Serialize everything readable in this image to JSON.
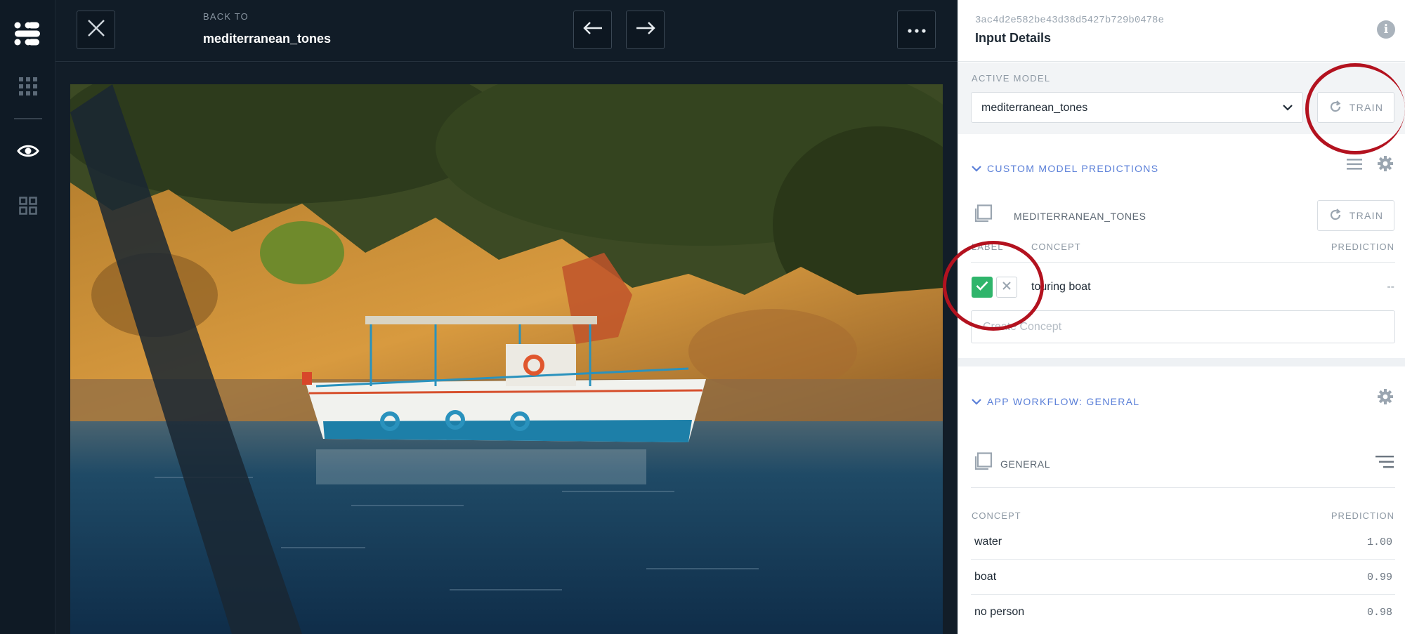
{
  "nav": {
    "back_to_label": "BACK TO",
    "back_to_name": "mediterranean_tones"
  },
  "icons": {
    "logo": "logo-icon",
    "apps": "grid-icon",
    "explorer": "eye-icon",
    "modules": "tiles-icon",
    "close": "close-icon",
    "prev": "arrow-left-icon",
    "next": "arrow-right-icon",
    "more": "more-dots-icon",
    "info": "info-icon",
    "refresh": "refresh-icon",
    "settings": "gear-icon",
    "list": "list-icon",
    "sort": "sort-icon",
    "copy": "copy-icon",
    "check": "check-icon",
    "reject": "x-icon"
  },
  "panel": {
    "input_id": "3ac4d2e582be43d38d5427b729b0478e",
    "title": "Input Details",
    "info_glyph": "i",
    "active_model_label": "ACTIVE MODEL",
    "active_model_value": "mediterranean_tones",
    "train_label": "TRAIN",
    "custom_section": {
      "title": "CUSTOM MODEL PREDICTIONS",
      "model_name": "MEDITERRANEAN_TONES",
      "train_label": "TRAIN",
      "col_label": "LABEL",
      "col_concept": "CONCEPT",
      "col_prediction": "PREDICTION",
      "concept": "touring boat",
      "prediction": "--",
      "create_placeholder": "Create Concept"
    },
    "workflow_section": {
      "title": "APP WORKFLOW: GENERAL",
      "model_name": "GENERAL",
      "col_concept": "CONCEPT",
      "col_prediction": "PREDICTION",
      "rows": [
        {
          "concept": "water",
          "value": "1.00"
        },
        {
          "concept": "boat",
          "value": "0.99"
        },
        {
          "concept": "no person",
          "value": "0.98"
        }
      ]
    }
  },
  "colors": {
    "accent_blue": "#5a7fd8",
    "success_green": "#2fb56b",
    "annotation_red": "#b3121f",
    "dark_bg": "#0f1a25"
  }
}
